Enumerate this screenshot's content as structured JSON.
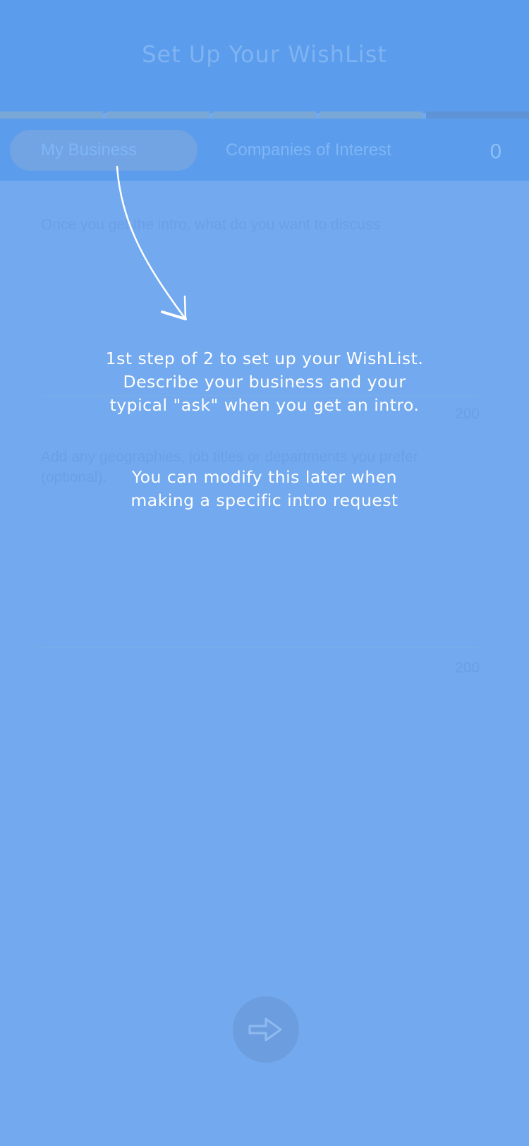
{
  "header": {
    "title": "Set Up Your WishList"
  },
  "progress": {
    "segments": 5,
    "completed": 4
  },
  "tabs": {
    "active_label": "My Business",
    "inactive_label": "Companies of Interest",
    "count": "0"
  },
  "form": {
    "discuss_label": "Once you get the intro, what do you want to discuss",
    "discuss_counter": "200",
    "preferences_label": "Add any geographies, job titles or departments you prefer (optional).",
    "preferences_counter": "200"
  },
  "overlay": {
    "instruction": "1st step of 2 to set up your WishList. Describe your business and your typical \"ask\" when you get an intro.",
    "note": "You can modify this later when making a specific intro request"
  },
  "icons": {
    "next": "arrow-right-icon",
    "pointer": "curved-arrow-icon"
  },
  "colors": {
    "accent": "#5b9cec",
    "overlay_text": "#ffffff"
  }
}
